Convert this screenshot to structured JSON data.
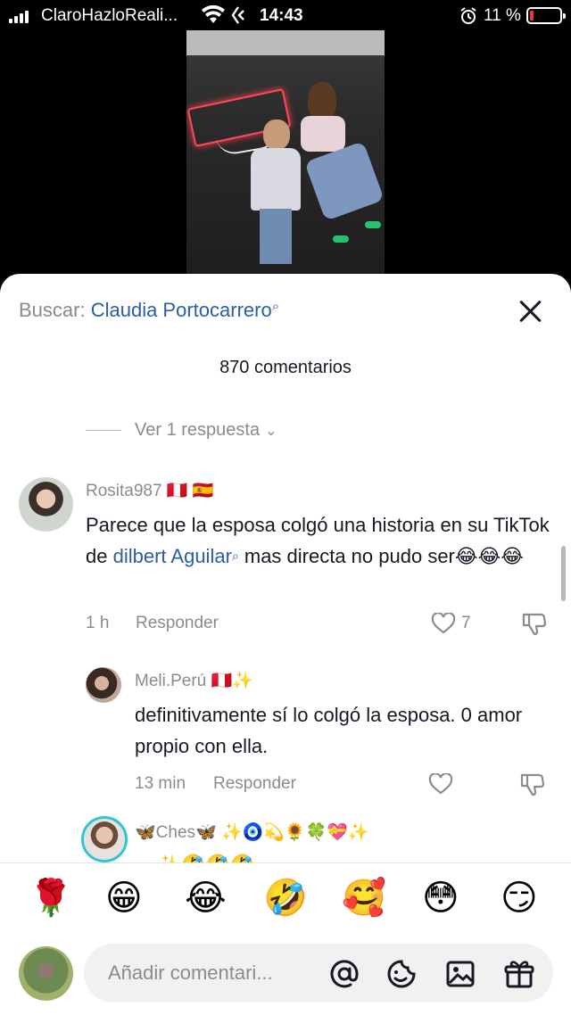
{
  "status_bar": {
    "carrier": "ClaroHazloReali...",
    "time": "14:43",
    "battery_percent": "11 %",
    "battery_level": 0.11
  },
  "video": {
    "description_icon": "video-thumbnail"
  },
  "search": {
    "label": "Buscar:",
    "term": "Claudia Portocarrero"
  },
  "comments_count": "870 comentarios",
  "view_replies": "Ver 1 respuesta",
  "comments": [
    {
      "username": "Rosita987",
      "flags": "🇵🇪 🇪🇸",
      "text_before": "Parece que la esposa colgó una historia en su TikTok de ",
      "mention": "dilbert Aguilar",
      "text_after": " mas directa no pudo ser😂😂😂",
      "time": "1 h",
      "reply_label": "Responder",
      "likes": "7"
    },
    {
      "username": "Meli.Perú",
      "flags": "🇵🇪✨",
      "text": "definitivamente sí lo colgó la esposa. 0 amor propio con ella.",
      "time": "13 min",
      "reply_label": "Responder"
    },
    {
      "username": "🦋Ches🦋",
      "flags": "✨🧿💫🌻🍀💝✨",
      "text": "... ✨🤣🤣🤣"
    }
  ],
  "quick_emojis": [
    "🌹",
    "😁",
    "😂",
    "🤣",
    "🥰",
    "😳",
    "😏"
  ],
  "composer": {
    "placeholder": "Añadir comentari..."
  },
  "colors": {
    "accent_link": "#2b5dab",
    "muted_text": "#8a8b91",
    "primary_text": "#161823",
    "battery_low": "#e53935"
  }
}
